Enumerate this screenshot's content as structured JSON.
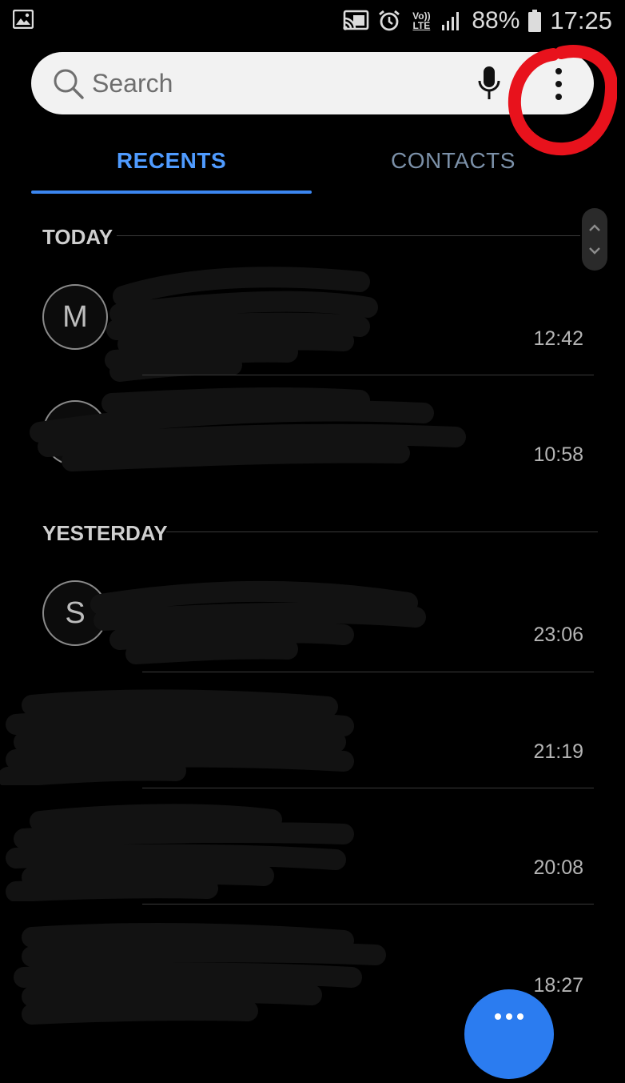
{
  "status_bar": {
    "battery_percent": "88%",
    "time": "17:25",
    "network_label": "Vo)) LTE",
    "icons": [
      "gallery-icon",
      "cast-icon",
      "alarm-icon",
      "volte-icon",
      "signal-icon",
      "battery-icon"
    ]
  },
  "search": {
    "placeholder": "Search",
    "icons": [
      "search-icon",
      "mic-icon",
      "more-options-icon"
    ]
  },
  "tabs": [
    {
      "label": "RECENTS",
      "active": true
    },
    {
      "label": "CONTACTS",
      "active": false
    }
  ],
  "sections": [
    {
      "header": "TODAY",
      "calls": [
        {
          "avatar_letter": "M",
          "time": "12:42"
        },
        {
          "avatar_letter": "",
          "time": "10:58"
        }
      ]
    },
    {
      "header": "YESTERDAY",
      "calls": [
        {
          "avatar_letter": "S",
          "time": "23:06"
        },
        {
          "avatar_letter": "",
          "time": "21:19"
        },
        {
          "avatar_letter": "",
          "time": "20:08"
        },
        {
          "avatar_letter": "",
          "time": "18:27"
        }
      ]
    }
  ],
  "colors": {
    "background": "#000000",
    "accent": "#4f9bff",
    "annotation": "#e8121c",
    "fab": "#2b7cf0"
  }
}
